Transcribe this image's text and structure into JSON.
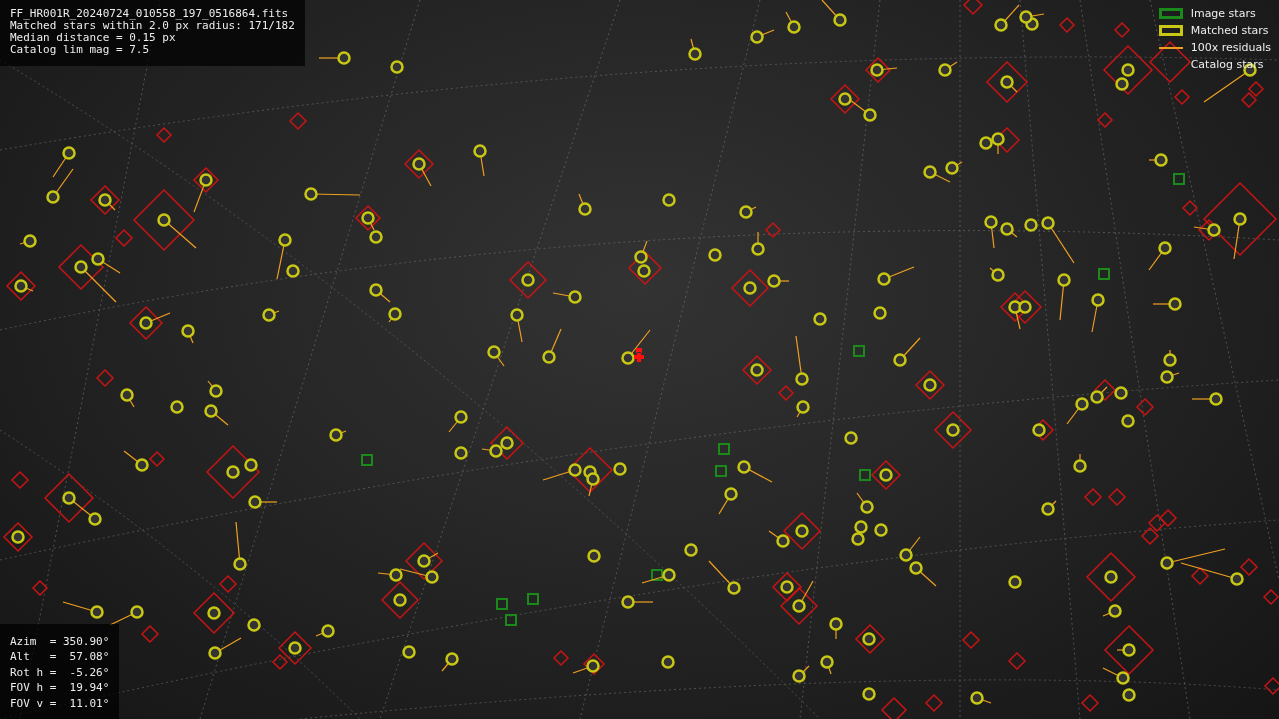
{
  "file_info": {
    "lines": [
      "FF_HR001R_20240724_010558_197_0516864.fits",
      "Matched stars within 2.0 px radius: 171/182",
      "Median distance = 0.15 px",
      "Catalog lim mag = 7.5"
    ]
  },
  "legend": [
    {
      "kind": "box",
      "label": "Image stars",
      "color": "#1a8a1a"
    },
    {
      "kind": "box",
      "label": "Matched stars",
      "color": "#c8c814"
    },
    {
      "kind": "line",
      "label": "100x residuals",
      "color": "#f0a020"
    },
    {
      "kind": "diamond",
      "label": "Catalog stars"
    }
  ],
  "pointing": {
    "lines": [
      "Azim  = 350.90°",
      "Alt   =  57.08°",
      "Rot h =  -5.26°",
      "FOV h =  19.94°",
      "FOV v =  11.01°"
    ]
  }
}
